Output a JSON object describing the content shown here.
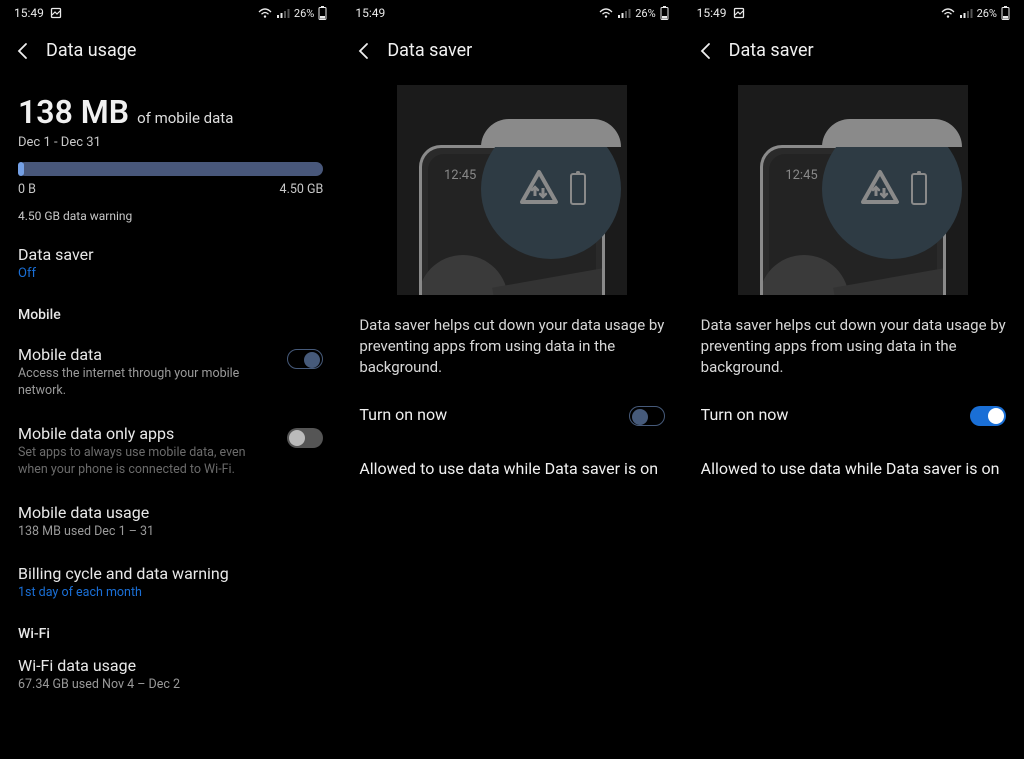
{
  "status": {
    "time": "15:49",
    "battery_pct": "26%",
    "has_screenshot_icon": true
  },
  "screen1": {
    "title": "Data usage",
    "usage_amount": "138 MB",
    "usage_suffix": "of mobile data",
    "period": "Dec 1 - Dec 31",
    "bar": {
      "min": "0 B",
      "max": "4.50 GB",
      "warning": "4.50 GB data warning"
    },
    "datasaver": {
      "title": "Data saver",
      "status": "Off"
    },
    "section_mobile": "Mobile",
    "mobile_data": {
      "title": "Mobile data",
      "desc": "Access the internet through your mobile network."
    },
    "only_apps": {
      "title": "Mobile data only apps",
      "desc": "Set apps to always use mobile data, even when your phone is connected to Wi-Fi."
    },
    "usage_row": {
      "title": "Mobile data usage",
      "desc": "138 MB used Dec 1 – 31"
    },
    "billing": {
      "title": "Billing cycle and data warning",
      "desc": "1st day of each month"
    },
    "section_wifi": "Wi-Fi",
    "wifi_usage": {
      "title": "Wi-Fi data usage",
      "desc": "67.34 GB used Nov 4 – Dec 2"
    }
  },
  "screen2": {
    "title": "Data saver",
    "illus_time": "12:45",
    "body": "Data saver helps cut down your data usage by preventing apps from using data in the background.",
    "turn_on": "Turn on now",
    "toggle_on": false,
    "allowed": "Allowed to use data while Data saver is on"
  },
  "screen3": {
    "title": "Data saver",
    "illus_time": "12:45",
    "body": "Data saver helps cut down your data usage by preventing apps from using data in the background.",
    "turn_on": "Turn on now",
    "toggle_on": true,
    "allowed": "Allowed to use data while Data saver is on"
  }
}
